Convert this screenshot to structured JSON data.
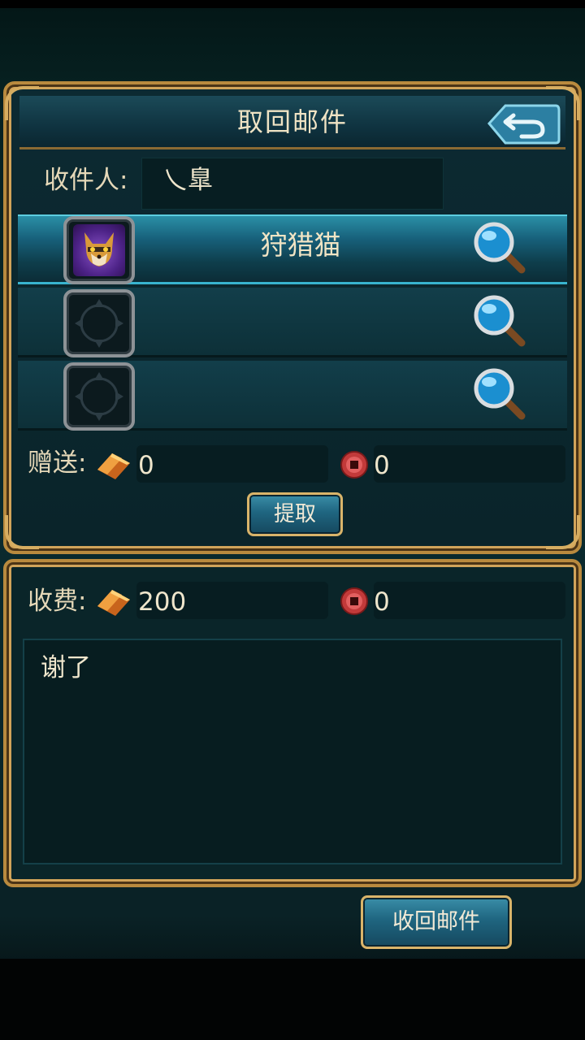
{
  "panel": {
    "title": "取回邮件",
    "recipient_label": "收件人:",
    "recipient_value": "乀臯"
  },
  "items": [
    {
      "name": "狩猎猫",
      "has_item": true,
      "selected": true
    },
    {
      "name": "",
      "has_item": false,
      "selected": false
    },
    {
      "name": "",
      "has_item": false,
      "selected": false
    }
  ],
  "gift": {
    "label": "赠送:",
    "gold": "0",
    "coin": "0"
  },
  "extract_button": "提取",
  "fee": {
    "label": "收费:",
    "gold": "200",
    "coin": "0"
  },
  "message": "谢了",
  "recall_button": "收回邮件",
  "colors": {
    "gold_frame": "#b98a3e",
    "selected_row": "#2a8fa6",
    "text": "#efe6cc"
  },
  "icons": [
    "back-arrow-icon",
    "magnifier-icon",
    "gold-ingot-icon",
    "coin-icon",
    "empty-slot-icon"
  ]
}
